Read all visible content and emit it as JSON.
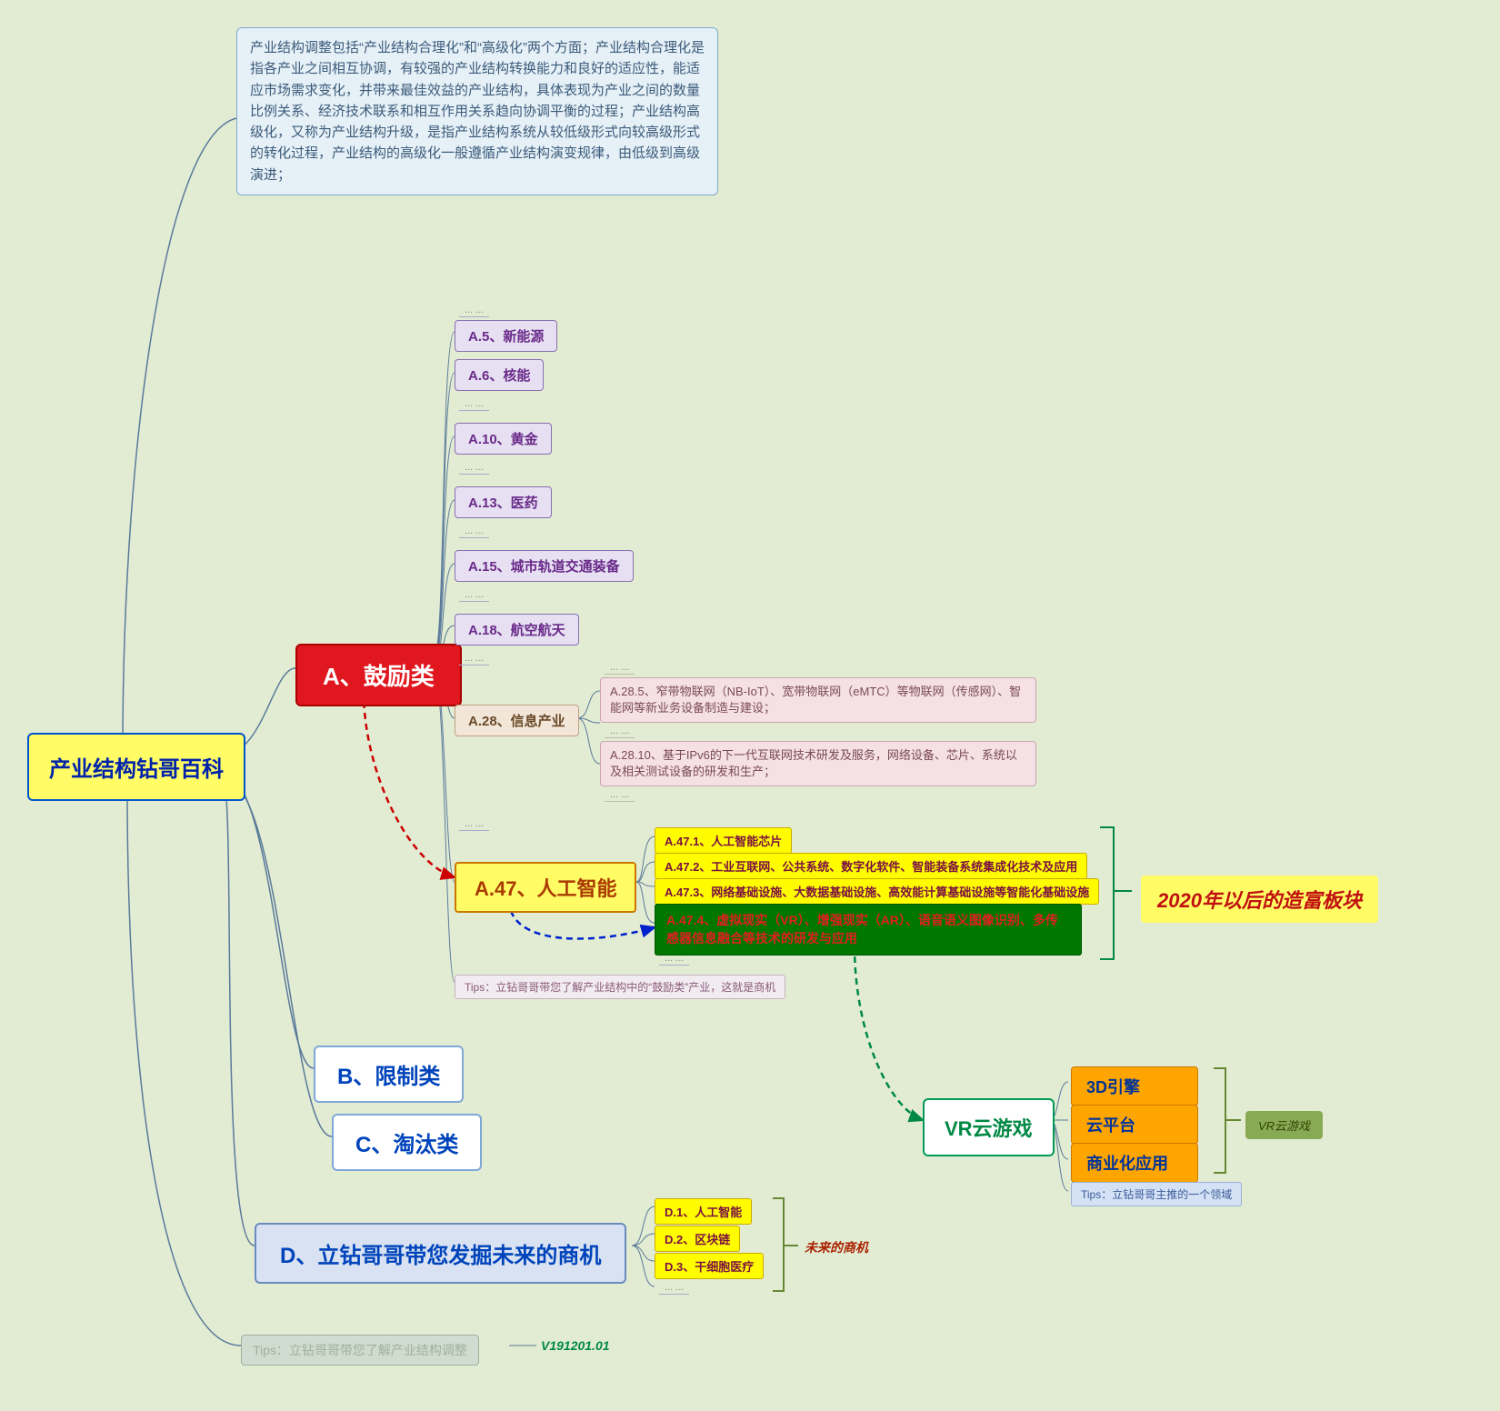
{
  "root": "产业结构钻哥百科",
  "description": "产业结构调整包括“产业结构合理化”和“高级化”两个方面；产业结构合理化是指各产业之间相互协调，有较强的产业结构转换能力和良好的适应性，能适应市场需求变化，并带来最佳效益的产业结构，具体表现为产业之间的数量比例关系、经济技术联系和相互作用关系趋向协调平衡的过程；产业结构高级化，又称为产业结构升级，是指产业结构系统从较低级形式向较高级形式的转化过程，产业结构的高级化一般遵循产业结构演变规律，由低级到高级演进；",
  "cat_a": "A、鼓励类",
  "cat_b": "B、限制类",
  "cat_c": "C、淘汰类",
  "cat_d": "D、立钻哥哥带您发掘未来的商机",
  "a_items": {
    "a5": "A.5、新能源",
    "a6": "A.6、核能",
    "a10": "A.10、黄金",
    "a13": "A.13、医药",
    "a15": "A.15、城市轨道交通装备",
    "a18": "A.18、航空航天",
    "a28": "A.28、信息产业",
    "a47": "A.47、人工智能"
  },
  "dots": "... ...",
  "a28_sub": {
    "s1": "A.28.5、窄带物联网（NB-IoT）、宽带物联网（eMTC）等物联网（传感网）、智能网等新业务设备制造与建设；",
    "s2": "A.28.10、基于IPv6的下一代互联网技术研发及服务，网络设备、芯片、系统以及相关测试设备的研发和生产；"
  },
  "a47_sub": {
    "s1": "A.47.1、人工智能芯片",
    "s2": "A.47.2、工业互联网、公共系统、数字化软件、智能装备系统集成化技术及应用",
    "s3": "A.47.3、网络基础设施、大数据基础设施、高效能计算基础设施等智能化基础设施",
    "s4": "A.47.4、虚拟现实（VR）、增强现实（AR）、语音语义图像识别、多传感器信息融合等技术的研发与应用"
  },
  "rich_label": "2020年以后的造富板块",
  "a_tips": "Tips：立钻哥哥带您了解产业结构中的“鼓励类”产业，这就是商机",
  "vr": {
    "main": "VR云游戏",
    "s1": "3D引擎",
    "s2": "云平台",
    "s3": "商业化应用",
    "label": "VR云游戏",
    "tips": "Tips：立钻哥哥主推的一个领域"
  },
  "d_sub": {
    "d1": "D.1、人工智能",
    "d2": "D.2、区块链",
    "d3": "D.3、干细胞医疗"
  },
  "future_label": "未来的商机",
  "bottom_tips": "Tips：立钻哥哥带您了解产业结构调整",
  "version": "V191201.01"
}
